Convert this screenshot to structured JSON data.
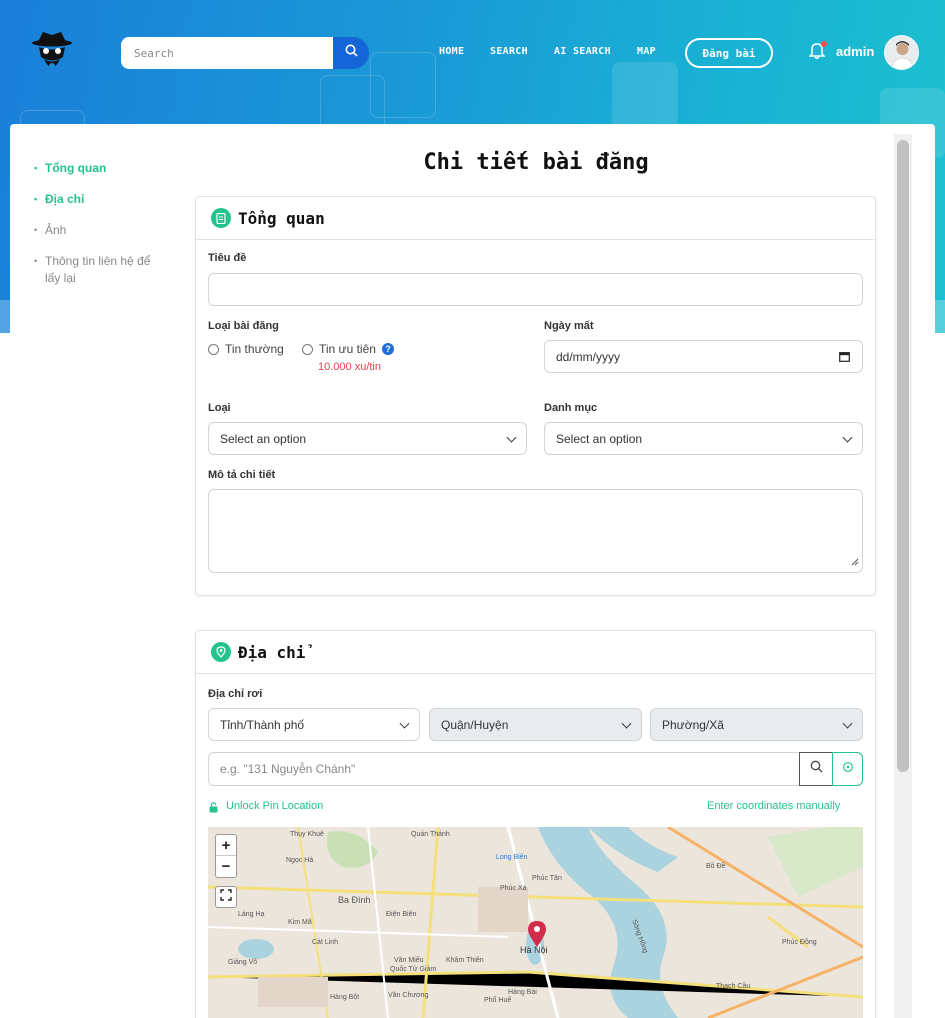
{
  "header": {
    "search_placeholder": "Search",
    "nav": [
      "HOME",
      "SEARCH",
      "AI SEARCH",
      "MAP"
    ],
    "post_button": "Đăng bài",
    "user_name": "admin"
  },
  "sidebar": {
    "items": [
      {
        "label": "Tổng quan",
        "active": true
      },
      {
        "label": "Địa chỉ",
        "active": true
      },
      {
        "label": "Ảnh",
        "active": false
      },
      {
        "label": "Thông tin liên hệ để lấy lại",
        "active": false
      }
    ]
  },
  "page": {
    "title": "Chi tiết bài đăng"
  },
  "overview": {
    "heading": "Tổng quan",
    "title_label": "Tiêu đề",
    "title_value": "",
    "post_type_label": "Loại bài đăng",
    "post_type_options": [
      "Tin thường",
      "Tin ưu tiên"
    ],
    "priority_price": "10.000 xu/tin",
    "lost_date_label": "Ngày mất",
    "lost_date_placeholder": "dd/mm/yyyy",
    "type_label": "Loại",
    "type_value": "Select an option",
    "category_label": "Danh mục",
    "category_value": "Select an option",
    "description_label": "Mô tả chi tiết",
    "description_value": ""
  },
  "address": {
    "heading": "Địa chỉ",
    "drop_address_label": "Địa chỉ rơi",
    "province": "Tỉnh/Thành phố",
    "district": "Quận/Huyện",
    "ward": "Phường/Xã",
    "street_placeholder": "e.g. \"131 Nguyễn Chánh\"",
    "unlock_pin": "Unlock Pin Location",
    "enter_coords": "Enter coordinates manually"
  },
  "map": {
    "zoom_in": "+",
    "zoom_out": "−",
    "labels": [
      "Thụy Khuê",
      "Quán Thánh",
      "Long Biên",
      "Ngọc Hà",
      "Phúc Xá",
      "Ba Đình",
      "Phúc Tân",
      "Kim Mã",
      "Điện Biên",
      "Láng Hạ",
      "Hà Nội",
      "Giảng Võ",
      "Hàng Bột",
      "Văn Miếu",
      "Quốc Tử Giám",
      "Văn Chương",
      "Khâm Thiên",
      "Hàng Bài",
      "Phố Huế",
      "Bồ Đề",
      "Thạch Cầu",
      "Sông Hồng",
      "Cát Linh",
      "Phúc Đồng"
    ]
  },
  "colors": {
    "accent": "#22c38e",
    "primary": "#1565d8",
    "price": "#e0424c"
  }
}
